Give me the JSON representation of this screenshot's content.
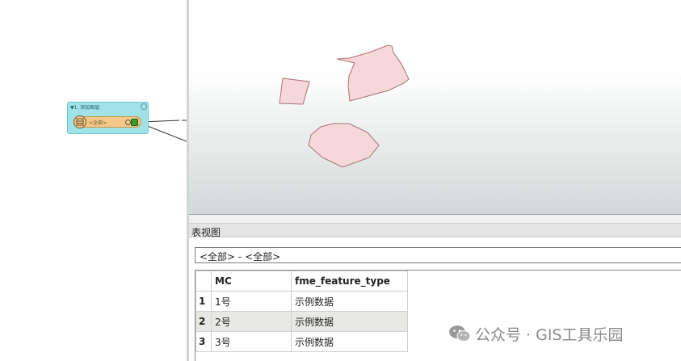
{
  "workspace": {
    "bookmark": {
      "title": "▼1. 添加图层"
    },
    "reader": {
      "label": "<全部>"
    }
  },
  "graphics": {
    "fill_color": "#f7d8da",
    "stroke_color": "#b07a7e",
    "polygons": 3
  },
  "table_view": {
    "title": "表视图",
    "filter": "<全部> - <全部>",
    "columns": [
      "MC",
      "fme_feature_type"
    ],
    "rows": [
      {
        "num": "1",
        "MC": "1号",
        "fme_feature_type": "示例数据"
      },
      {
        "num": "2",
        "MC": "2号",
        "fme_feature_type": "示例数据"
      },
      {
        "num": "3",
        "MC": "3号",
        "fme_feature_type": "示例数据"
      }
    ]
  },
  "watermark": {
    "icon": "wechat-icon",
    "text": "公众号 · GIS工具乐园"
  },
  "colors": {
    "bookmark": "#9fe3e8",
    "reader_node": "#f2c98a",
    "port": "#3c9a2e",
    "alt_row": "#e8e8e4"
  }
}
